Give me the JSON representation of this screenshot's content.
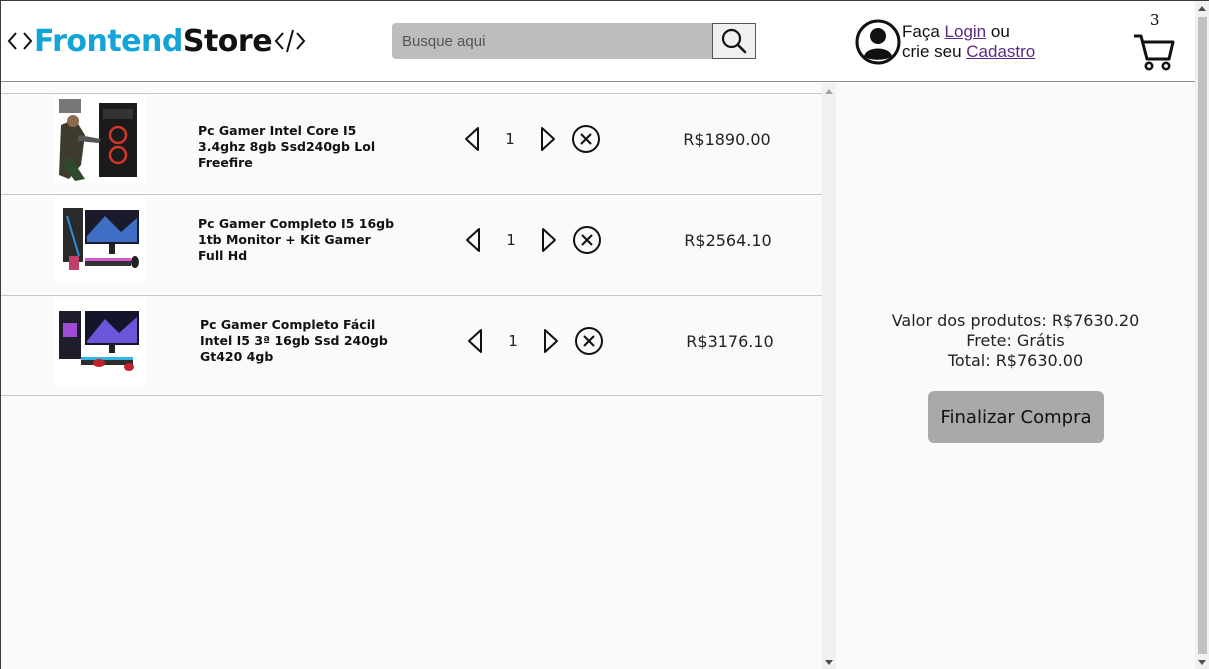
{
  "header": {
    "logo": {
      "part1": "Frontend",
      "part2": "Store",
      "left_symbol": "<>",
      "right_symbol": "</>"
    },
    "search": {
      "placeholder": "Busque aqui",
      "value": "",
      "button_icon": "search-icon"
    },
    "user": {
      "prefix": "Faça",
      "login_link": "Login",
      "middle": "ou",
      "line2_prefix": "crie seu",
      "signup_link": "Cadastro",
      "icon": "user-avatar-icon"
    },
    "cart": {
      "count": "3",
      "icon": "shopping-cart-icon"
    }
  },
  "cart_items": [
    {
      "name": "Pc Gamer Intel Core I5 3.4ghz 8gb Ssd240gb Lol Freefire",
      "quantity": "1",
      "price": "R$1890.00"
    },
    {
      "name": "Pc Gamer Completo I5 16gb 1tb Monitor + Kit Gamer Full Hd",
      "quantity": "1",
      "price": "R$2564.10"
    },
    {
      "name": "Pc Gamer Completo Fácil Intel I5 3ª 16gb Ssd 240gb Gt420 4gb",
      "quantity": "1",
      "price": "R$3176.10"
    }
  ],
  "summary": {
    "products_value": "Valor dos produtos: R$7630.20",
    "shipping": "Frete: Grátis",
    "total": "Total: R$7630.00",
    "checkout_label": "Finalizar Compra"
  },
  "colors": {
    "brand_blue": "#12a4d6",
    "link_purple": "#5b2a86",
    "search_bg": "#bdbdbd",
    "button_bg": "#a9a9a9"
  }
}
